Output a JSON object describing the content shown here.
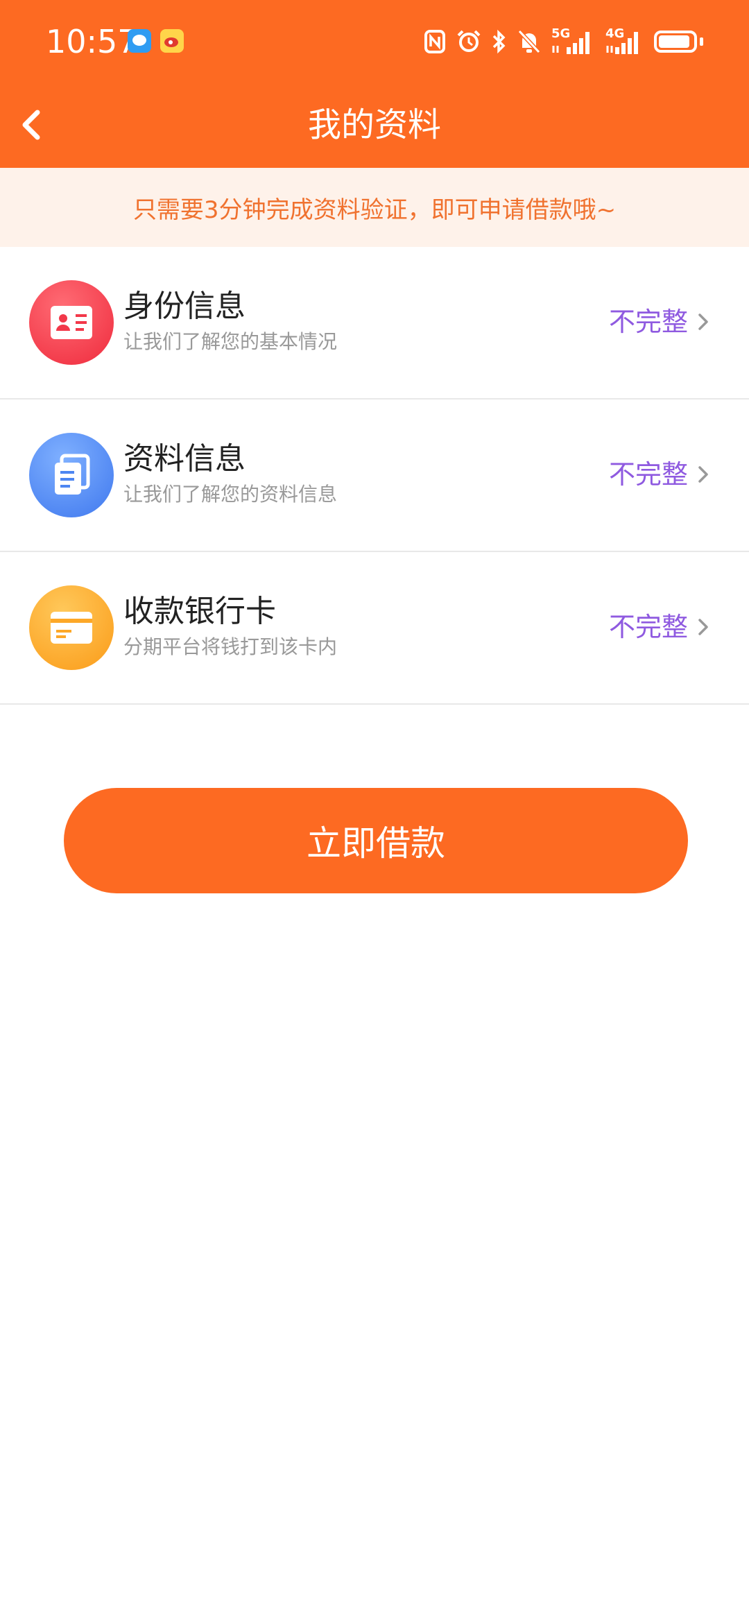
{
  "status_bar": {
    "time": "10:57",
    "icons": [
      "message-icon",
      "weibo-icon",
      "nfc-icon",
      "alarm-icon",
      "bluetooth-icon",
      "mute-icon",
      "5g-signal-icon",
      "4g-signal-icon",
      "battery-icon"
    ],
    "network_5g": "5G",
    "network_4g": "4G"
  },
  "header": {
    "title": "我的资料",
    "back_icon": "chevron-left-icon",
    "color": "#fd6a22"
  },
  "notice": {
    "text": "只需要3分钟完成资料验证，即可申请借款哦~"
  },
  "items": [
    {
      "title": "身份信息",
      "subtitle": "让我们了解您的基本情况",
      "status": "不完整",
      "icon": "id-card-icon",
      "color": "#f2384a"
    },
    {
      "title": "资料信息",
      "subtitle": "让我们了解您的资料信息",
      "status": "不完整",
      "icon": "document-icon",
      "color": "#4d86f2"
    },
    {
      "title": "收款银行卡",
      "subtitle": "分期平台将钱打到该卡内",
      "status": "不完整",
      "icon": "bank-card-icon",
      "color": "#fda828"
    }
  ],
  "status_color": "#8f5ae0",
  "action": {
    "label": "立即借款"
  }
}
